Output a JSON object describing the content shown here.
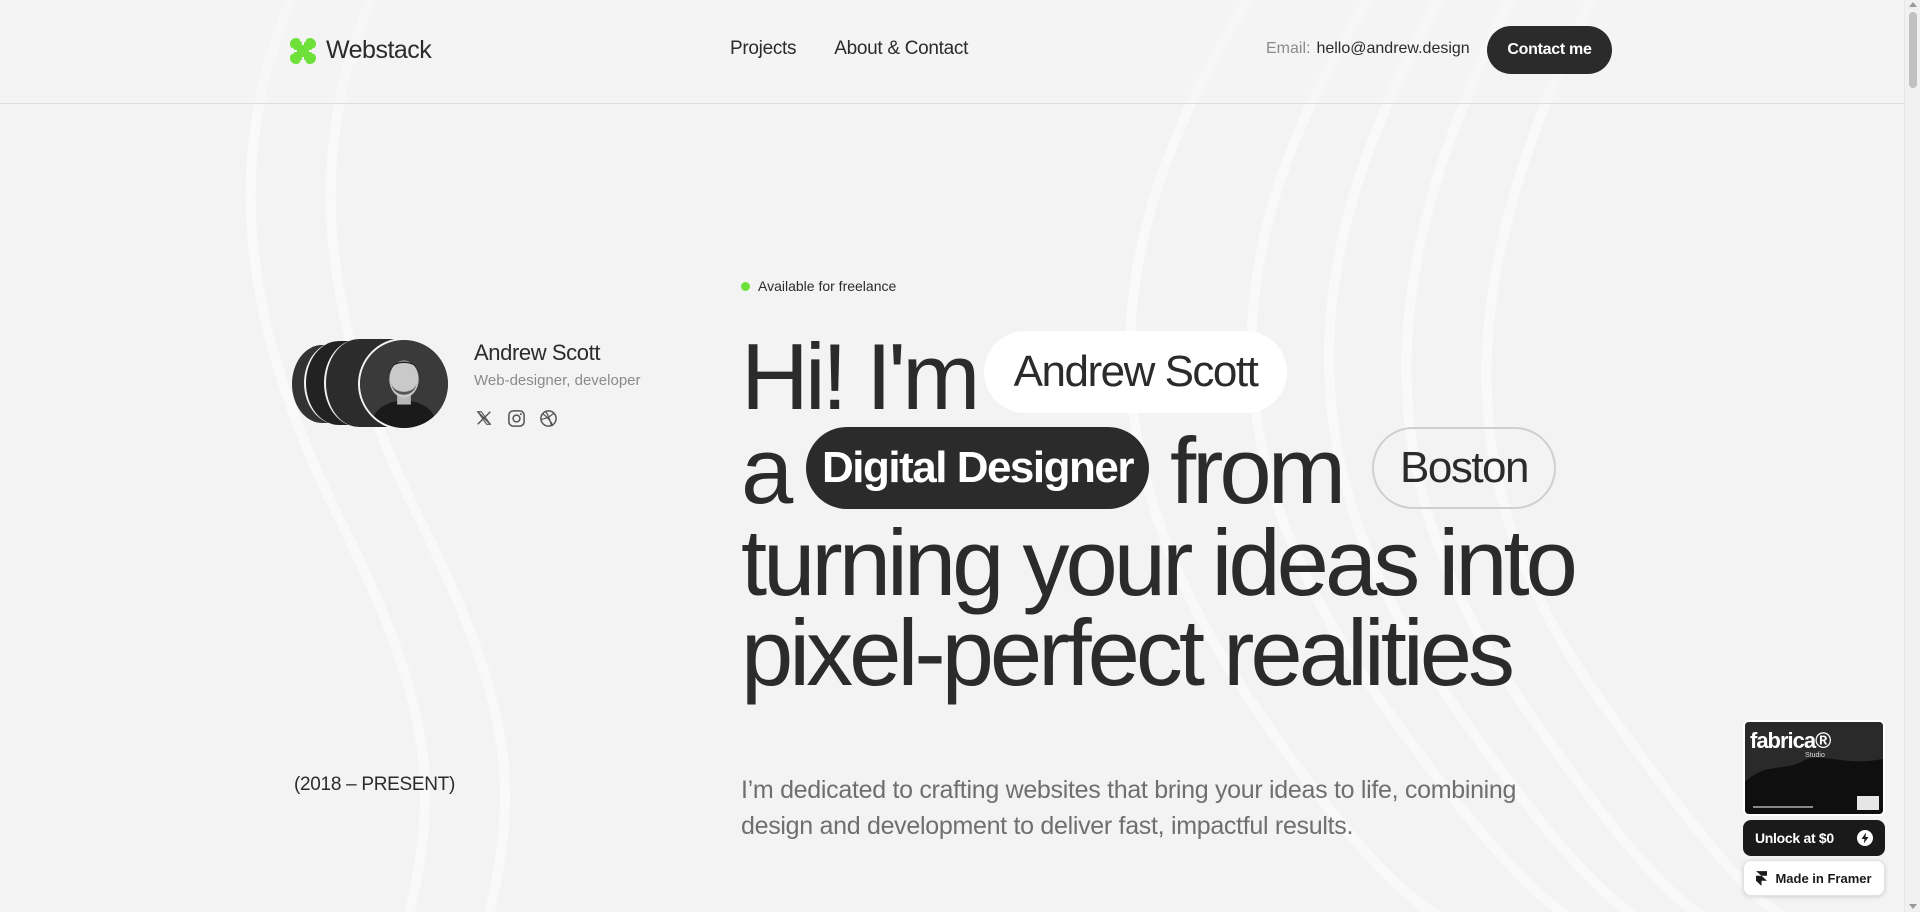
{
  "header": {
    "logo_text": "Webstack",
    "nav": [
      "Projects",
      "About & Contact"
    ],
    "email_label": "Email:",
    "email_value": "hello@andrew.design",
    "contact_button": "Contact me"
  },
  "profile": {
    "name": "Andrew Scott",
    "role": "Web-designer, developer",
    "socials": [
      "x-icon",
      "instagram-icon",
      "dribbble-icon"
    ],
    "years": "(2018 – PRESENT)"
  },
  "hero": {
    "status": "Available for freelance",
    "line1_text": "Hi! I'm",
    "name_pill": "Andrew Scott",
    "line2_a": "a",
    "role_pill": "Digital Designer",
    "line2_from": "from",
    "city_pill": "Boston",
    "line3": "turning your ideas into",
    "line4": "pixel-perfect realities",
    "description": "I’m dedicated to crafting websites that bring your ideas to life, combining design and development to deliver fast, impactful results."
  },
  "widget": {
    "brand": "fabrica®",
    "brand_sub": "Studio",
    "unlock_label": "Unlock at $0",
    "made_label": "Made in Framer"
  },
  "colors": {
    "accent_green": "#6ee03a",
    "dark": "#2b2b2b",
    "background": "#f3f3f3"
  }
}
